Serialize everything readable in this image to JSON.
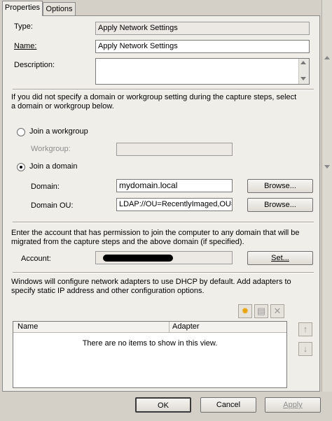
{
  "tabs": [
    {
      "label": "Properties"
    },
    {
      "label": "Options"
    }
  ],
  "form": {
    "type_label": "Type:",
    "type_value": "Apply Network Settings",
    "name_label": "Name:",
    "name_value": "Apply Network Settings",
    "description_label": "Description:",
    "description_value": ""
  },
  "domain_section": {
    "info": "If you did not specify a domain or workgroup setting during the capture steps, select a domain or workgroup below.",
    "join_workgroup_label": "Join a workgroup",
    "workgroup_label": "Workgroup:",
    "workgroup_value": "",
    "join_domain_label": "Join a domain",
    "domain_label": "Domain:",
    "domain_value": "mydomain.local",
    "domain_ou_label": "Domain OU:",
    "domain_ou_value": "LDAP://OU=RecentlyImaged,OU=",
    "browse_label": "Browse...",
    "browse_ou_label": "Browse...",
    "selected": "domain"
  },
  "account_section": {
    "info": "Enter the account that has permission to join the computer to any domain that will be migrated from the capture steps and the above domain (if specified).",
    "account_label": "Account:",
    "account_value": "",
    "set_label": "Set..."
  },
  "adapters_section": {
    "info": "Windows will configure network adapters to use DHCP by default. Add adapters to specify static IP address and other configuration options.",
    "columns": [
      "Name",
      "Adapter"
    ],
    "empty_text": "There are no items to show in this view."
  },
  "footer": {
    "ok_label": "OK",
    "cancel_label": "Cancel",
    "apply_label": "Apply"
  }
}
